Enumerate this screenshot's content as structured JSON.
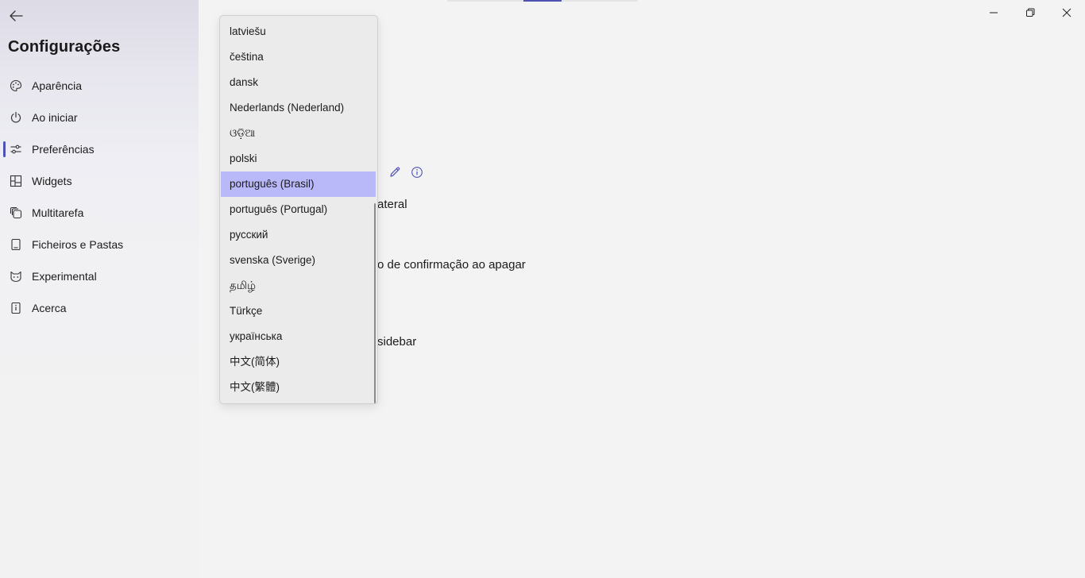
{
  "sidebar": {
    "title": "Configurações",
    "items": [
      {
        "label": "Aparência",
        "icon": "palette-icon"
      },
      {
        "label": "Ao iniciar",
        "icon": "power-icon"
      },
      {
        "label": "Preferências",
        "icon": "sliders-icon",
        "active": true
      },
      {
        "label": "Widgets",
        "icon": "widgets-icon"
      },
      {
        "label": "Multitarefa",
        "icon": "multitask-icon"
      },
      {
        "label": "Ficheiros e Pastas",
        "icon": "file-icon"
      },
      {
        "label": "Experimental",
        "icon": "experimental-icon"
      },
      {
        "label": "Acerca",
        "icon": "info-box-icon"
      }
    ]
  },
  "main": {
    "partial_texts": [
      "ateral",
      "o de confirmação ao apagar",
      "sidebar"
    ]
  },
  "language_dropdown": {
    "selected": "português (Brasil)",
    "options": [
      "latviešu",
      "čeština",
      "dansk",
      "Nederlands (Nederland)",
      "ଓଡ଼ିଆ",
      "polski",
      "português (Brasil)",
      "português (Portugal)",
      "русский",
      "svenska (Sverige)",
      "தமிழ்",
      "Türkçe",
      "українська",
      "中文(简体)",
      "中文(繁體)"
    ]
  },
  "colors": {
    "accent": "#4f52b2",
    "selected_item": "#b9b9fa"
  }
}
